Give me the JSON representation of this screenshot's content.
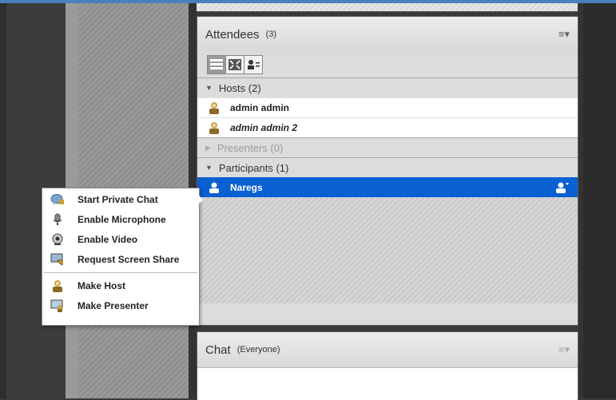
{
  "attendees": {
    "title": "Attendees",
    "count": "(3)",
    "groups": [
      {
        "label": "Hosts (2)",
        "expanded": true,
        "members": [
          {
            "name": "admin admin"
          },
          {
            "name": "admin admin 2"
          }
        ]
      },
      {
        "label": "Presenters (0)",
        "expanded": false,
        "members": []
      },
      {
        "label": "Participants (1)",
        "expanded": true,
        "members": [
          {
            "name": "Naregs",
            "selected": true
          }
        ]
      }
    ]
  },
  "chat": {
    "title": "Chat",
    "scope": "(Everyone)"
  },
  "context_menu": {
    "items": [
      {
        "label": "Start Private Chat",
        "icon": "private-chat-icon"
      },
      {
        "label": "Enable Microphone",
        "icon": "microphone-icon"
      },
      {
        "label": "Enable Video",
        "icon": "webcam-icon"
      },
      {
        "label": "Request Screen Share",
        "icon": "screen-share-icon"
      },
      {
        "label": "Make Host",
        "icon": "host-icon"
      },
      {
        "label": "Make Presenter",
        "icon": "presenter-icon"
      }
    ]
  },
  "colors": {
    "selection": "#0a5fd1",
    "frame_accent": "#4a7fc0"
  }
}
